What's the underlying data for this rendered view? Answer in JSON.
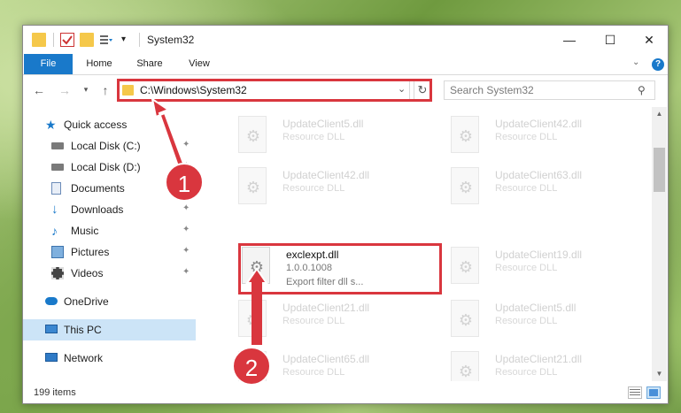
{
  "window": {
    "title": "System32",
    "controls": {
      "minimize": "—",
      "maximize": "☐",
      "close": "✕"
    }
  },
  "ribbon": {
    "tabs": [
      "File",
      "Home",
      "Share",
      "View"
    ],
    "help": "?"
  },
  "nav": {
    "address": "C:\\Windows\\System32",
    "search_placeholder": "Search System32"
  },
  "sidebar": {
    "items": [
      {
        "label": "Quick access",
        "icon": "star-icon"
      },
      {
        "label": "Local Disk (C:)",
        "icon": "drive-icon",
        "pinned": true
      },
      {
        "label": "Local Disk (D:)",
        "icon": "drive-icon",
        "pinned": true
      },
      {
        "label": "Documents",
        "icon": "documents-icon",
        "pinned": true
      },
      {
        "label": "Downloads",
        "icon": "downloads-icon",
        "pinned": true
      },
      {
        "label": "Music",
        "icon": "music-icon",
        "pinned": true
      },
      {
        "label": "Pictures",
        "icon": "pictures-icon",
        "pinned": true
      },
      {
        "label": "Videos",
        "icon": "videos-icon",
        "pinned": true
      },
      {
        "label": "OneDrive",
        "icon": "cloud-icon"
      },
      {
        "label": "This PC",
        "icon": "computer-icon",
        "selected": true
      },
      {
        "label": "Network",
        "icon": "network-icon"
      }
    ]
  },
  "files": [
    {
      "name": "UpdateClient5.dll",
      "desc": "Resource DLL"
    },
    {
      "name": "UpdateClient42.dll",
      "desc": "Resource DLL"
    },
    {
      "name": "UpdateClient42.dll",
      "desc": "Resource DLL"
    },
    {
      "name": "UpdateClient63.dll",
      "desc": "Resource DLL"
    },
    {
      "name": "exclexpt.dll",
      "desc": "1.0.0.1008",
      "desc2": "Export filter dll s..."
    },
    {
      "name": "UpdateClient19.dll",
      "desc": "Resource DLL"
    },
    {
      "name": "UpdateClient21.dll",
      "desc": "Resource DLL"
    },
    {
      "name": "UpdateClient5.dll",
      "desc": "Resource DLL"
    },
    {
      "name": "UpdateClient65.dll",
      "desc": "Resource DLL"
    },
    {
      "name": "UpdateClient21.dll",
      "desc": "Resource DLL"
    }
  ],
  "status": {
    "count": "199 items"
  },
  "callouts": {
    "one": "1",
    "two": "2"
  },
  "colors": {
    "accent": "#1979ca",
    "highlight": "#d9363e",
    "selected": "#cce4f7"
  }
}
